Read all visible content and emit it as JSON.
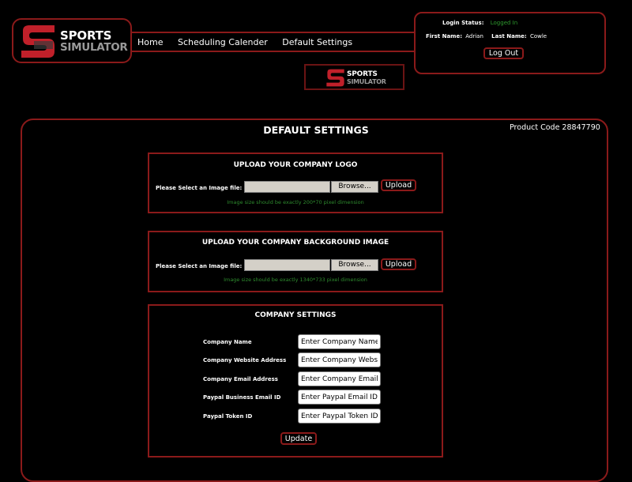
{
  "brand": {
    "line1": "SPORTS",
    "line2": "SIMULATOR"
  },
  "colors": {
    "accent": "#8b1a1a",
    "logo_red": "#c0202a",
    "hint_green": "#2e8b2e",
    "status_green": "#2e9b2e"
  },
  "nav": {
    "items": [
      "Home",
      "Scheduling Calender",
      "Default Settings"
    ]
  },
  "login": {
    "status_label": "Login Status:",
    "status_value": "Logged In",
    "first_name_label": "First Name:",
    "first_name_value": "Adrian",
    "last_name_label": "Last Name:",
    "last_name_value": "Cowle",
    "logout_label": "Log Out"
  },
  "page": {
    "title": "DEFAULT SETTINGS",
    "product_code": "Product Code 28847790"
  },
  "logo_upload": {
    "title": "UPLOAD YOUR COMPANY LOGO",
    "label": "Please Select an Image file:",
    "browse_label": "Browse...",
    "upload_label": "Upload",
    "hint": "Image size should be exactly 200*70 pixel dimension"
  },
  "bg_upload": {
    "title": "UPLOAD YOUR COMPANY BACKGROUND IMAGE",
    "label": "Please Select an Image file:",
    "browse_label": "Browse...",
    "upload_label": "Upload",
    "hint": "Image size should be exactly 1340*733 pixel dimension"
  },
  "company": {
    "title": "COMPANY SETTINGS",
    "fields": [
      {
        "label": "Company Name",
        "placeholder": "Enter Company Name"
      },
      {
        "label": "Company Website Address",
        "placeholder": "Enter Company Website"
      },
      {
        "label": "Company Email Address",
        "placeholder": "Enter Company Email ID"
      },
      {
        "label": "Paypal Business Email ID",
        "placeholder": "Enter Paypal Email ID"
      },
      {
        "label": "Paypal Token ID",
        "placeholder": "Enter Paypal Token ID"
      }
    ],
    "update_label": "Update"
  }
}
